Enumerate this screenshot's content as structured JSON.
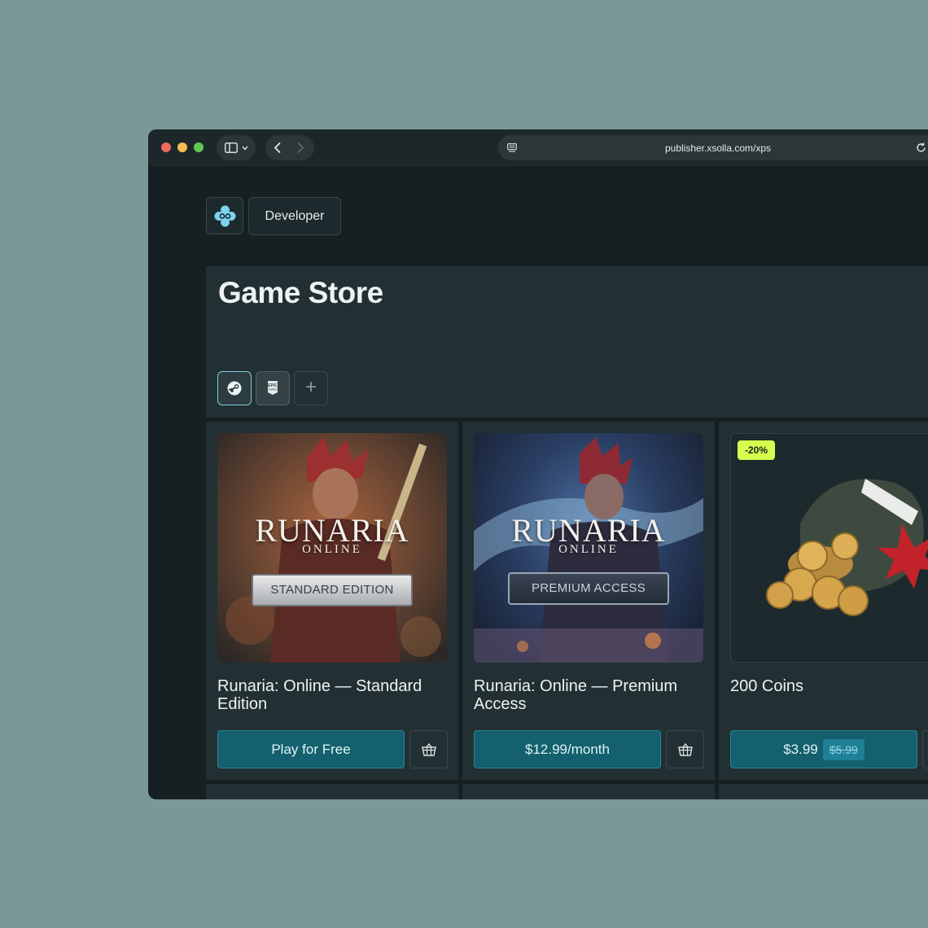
{
  "browser": {
    "url": "publisher.xsolla.com/xps",
    "icons": [
      "sidebar-icon",
      "chevron-down-icon",
      "back-icon",
      "forward-icon",
      "site-settings-icon",
      "reload-icon"
    ]
  },
  "header": {
    "developer_label": "Developer"
  },
  "store": {
    "title": "Game Store",
    "platforms": [
      "steam-icon",
      "epic-games-icon",
      "plus-icon"
    ],
    "add_label": "+"
  },
  "products": [
    {
      "title": "Runaria: Online — Standard Edition",
      "logo": "RUNARIA",
      "logo_sub": "ONLINE",
      "edition": "STANDARD EDITION",
      "button": "Play for Free"
    },
    {
      "title": "Runaria: Online — Premium Access",
      "logo": "RUNARIA",
      "logo_sub": "ONLINE",
      "edition": "PREMIUM ACCESS",
      "button": "$12.99/month"
    },
    {
      "title": "200 Coins",
      "discount": "-20%",
      "price": "$3.99",
      "old_price": "$5.99"
    }
  ],
  "colors": {
    "accent": "#14606e",
    "discount_badge": "#d5ff4d",
    "background": "#7a9799"
  }
}
